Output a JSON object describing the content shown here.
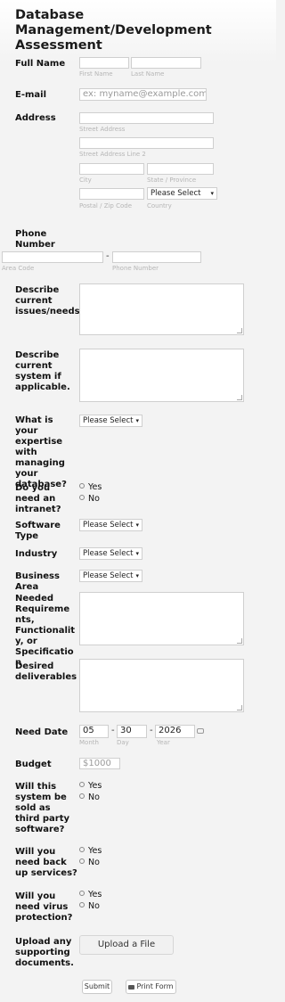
{
  "form": {
    "title": "Database Management/Development Assessment"
  },
  "full_name": {
    "label": "Full Name",
    "first_sub": "First Name",
    "last_sub": "Last Name"
  },
  "email": {
    "label": "E-mail",
    "placeholder": "ex: myname@example.com"
  },
  "address": {
    "label": "Address",
    "street_sub": "Street Address",
    "street2_sub": "Street Address Line 2",
    "city_sub": "City",
    "state_sub": "State / Province",
    "zip_sub": "Postal / Zip Code",
    "country_sub": "Country",
    "country_value": "Please Select"
  },
  "phone": {
    "label": "Phone Number",
    "area_sub": "Area Code",
    "number_sub": "Phone Number",
    "separator": "-"
  },
  "issues": {
    "label": "Describe current issues/needs"
  },
  "current_system": {
    "label": "Describe current system if applicable."
  },
  "expertise": {
    "label": "What is your expertise with managing your database?",
    "value": "Please Select"
  },
  "intranet": {
    "label": "Do you need an intranet?",
    "options": [
      "Yes",
      "No"
    ]
  },
  "software_type": {
    "label": "Software Type",
    "value": "Please Select"
  },
  "industry": {
    "label": "Industry",
    "value": "Please Select"
  },
  "business_area": {
    "label": "Business Area",
    "value": "Please Select"
  },
  "requirements": {
    "label": "Needed Requirements, Functionality, or Specification"
  },
  "deliverables": {
    "label": "Desired deliverables"
  },
  "need_date": {
    "label": "Need Date",
    "month": "05",
    "day": "30",
    "year": "2026",
    "month_sub": "Month",
    "day_sub": "Day",
    "year_sub": "Year",
    "separator": "-",
    "calendar_icon": "calendar-icon"
  },
  "budget": {
    "label": "Budget",
    "placeholder": "$1000"
  },
  "third_party": {
    "label": "Will this system be sold as third party software?",
    "options": [
      "Yes",
      "No"
    ]
  },
  "backup": {
    "label": "Will you need back up services?",
    "options": [
      "Yes",
      "No"
    ]
  },
  "virus": {
    "label": "Will you need virus protection?",
    "options": [
      "Yes",
      "No"
    ]
  },
  "upload": {
    "label": "Upload any supporting documents.",
    "button": "Upload a File"
  },
  "actions": {
    "submit": "Submit",
    "print": "Print Form",
    "print_icon": "printer-icon"
  }
}
